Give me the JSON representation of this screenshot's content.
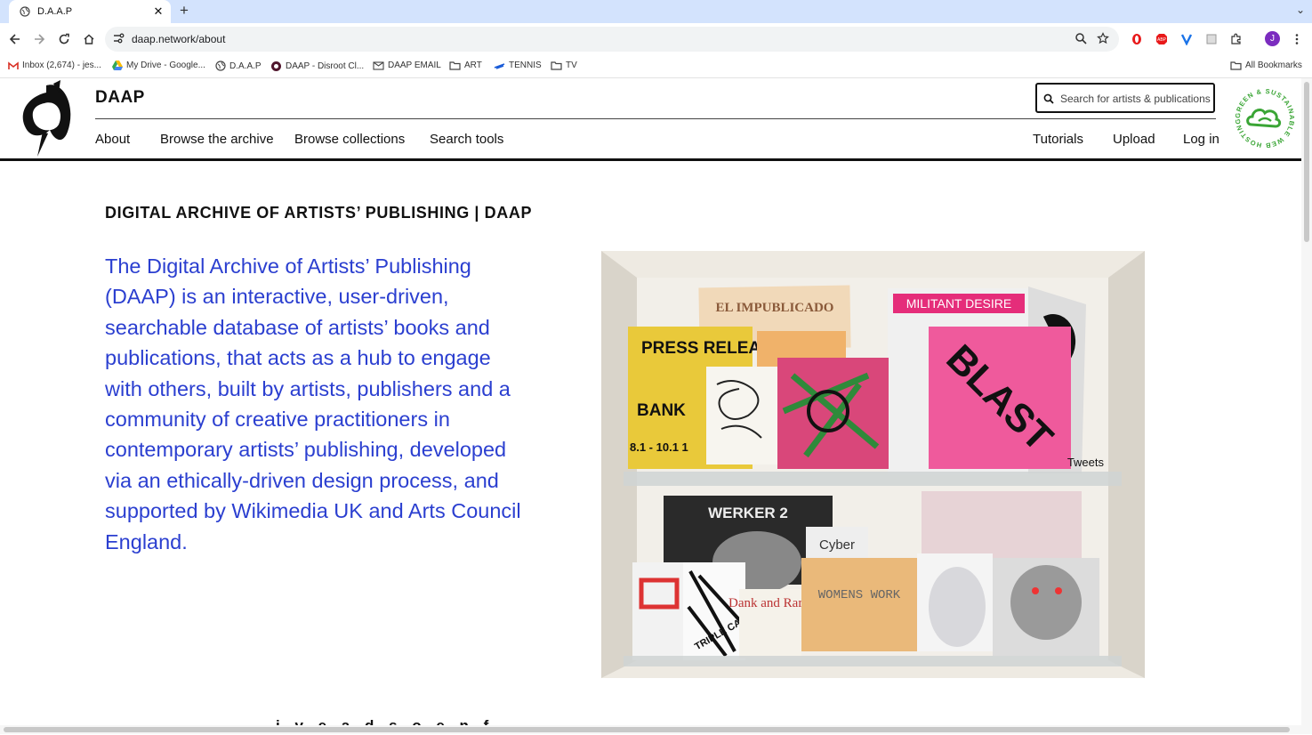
{
  "browser": {
    "tab_title": "D.A.A.P",
    "url": "daap.network/about",
    "bookmarks": [
      {
        "label": "Inbox (2,674) - jes...",
        "icon": "gmail-icon"
      },
      {
        "label": "My Drive - Google...",
        "icon": "drive-icon"
      },
      {
        "label": "D.A.A.P",
        "icon": "globe-icon"
      },
      {
        "label": "DAAP - Disroot Cl...",
        "icon": "disroot-icon"
      },
      {
        "label": "DAAP EMAIL",
        "icon": "mail-icon"
      },
      {
        "label": "ART",
        "icon": "folder-icon"
      },
      {
        "label": "TENNIS",
        "icon": "tennis-icon"
      },
      {
        "label": "TV",
        "icon": "folder-icon"
      }
    ],
    "all_bookmarks": "All Bookmarks",
    "avatar_letter": "J"
  },
  "site": {
    "brand": "DAAP",
    "search_placeholder": "Search for artists & publications",
    "nav_left": [
      "About",
      "Browse the archive",
      "Browse collections",
      "Search tools"
    ],
    "nav_right": [
      "Tutorials",
      "Upload",
      "Log in"
    ],
    "badge_text": "GREEN & SUSTAINABLE WEB HOSTING"
  },
  "main": {
    "heading": "DIGITAL ARCHIVE OF ARTISTS’ PUBLISHING | DAAP",
    "intro": "The Digital Archive of Artists’ Publishing (DAAP) is an interactive, user-driven, searchable database of artists’ books and publications, that acts as a hub to engage with others, built by artists, publishers and a community of creative practitioners in contemporary artists’ publishing, developed via an ethically-driven design process, and supported by Wikimedia UK and Arts Council England.",
    "image_titles": [
      "EL IMPUBLICADO",
      "MILITANT DESIRE",
      "PRESS RELEASE",
      "BANK",
      "8.1 - 10.1 1",
      "BLAST",
      "Tweets",
      "WERKER 2",
      "Cyber",
      "WOMENS WORK",
      "Dank and Rare",
      "TRIPLE CANOPY"
    ],
    "next_heading": "i v e a d s o e n f"
  },
  "colors": {
    "accent_blue": "#2b3fd0",
    "tabbar": "#d3e3fd",
    "green": "#3aa535"
  }
}
